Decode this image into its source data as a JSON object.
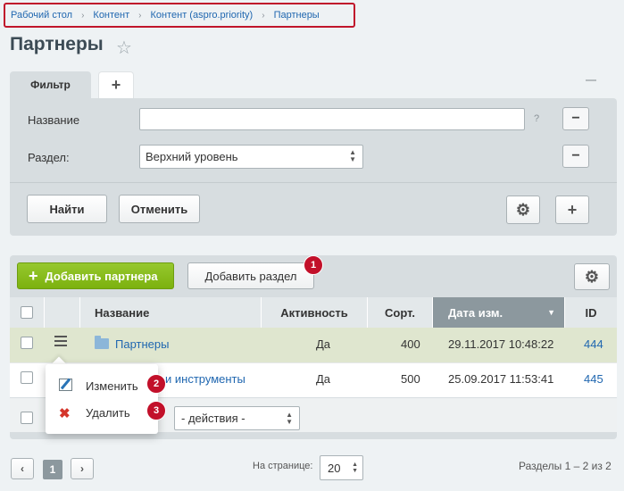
{
  "breadcrumb": {
    "items": [
      "Рабочий стол",
      "Контент",
      "Контент (aspro.priority)",
      "Партнеры"
    ],
    "separator": "›"
  },
  "page": {
    "title": "Партнеры"
  },
  "filter": {
    "tab_label": "Фильтр",
    "add_tab_label": "+",
    "fields": {
      "name_label": "Название",
      "name_value": "",
      "name_help": "?",
      "section_label": "Раздел:",
      "section_value": "Верхний уровень"
    },
    "find_button": "Найти",
    "cancel_button": "Отменить"
  },
  "toolbar": {
    "add_partner_button": "Добавить партнера",
    "add_section_button": "Добавить раздел"
  },
  "grid": {
    "columns": {
      "name": "Название",
      "active": "Активность",
      "sort": "Сорт.",
      "date": "Дата изм.",
      "id": "ID"
    },
    "rows": [
      {
        "name": "Партнеры",
        "active": "Да",
        "sort": "400",
        "date": "29.11.2017 10:48:22",
        "id": "444"
      },
      {
        "name": "и инструменты",
        "active": "Да",
        "sort": "500",
        "date": "25.09.2017 11:53:41",
        "id": "445"
      }
    ],
    "actions_placeholder": "- действия -"
  },
  "context_menu": {
    "edit_label": "Изменить",
    "delete_label": "Удалить"
  },
  "badges": [
    "1",
    "2",
    "3"
  ],
  "pagination": {
    "prev": "‹",
    "current": "1",
    "next": "›",
    "per_page_label": "На странице:",
    "per_page_value": "20",
    "total": "Разделы 1 – 2 из 2"
  },
  "colors": {
    "accent_green": "#7cb10e",
    "link_blue": "#2067b0",
    "badge_red": "#c2102a"
  }
}
